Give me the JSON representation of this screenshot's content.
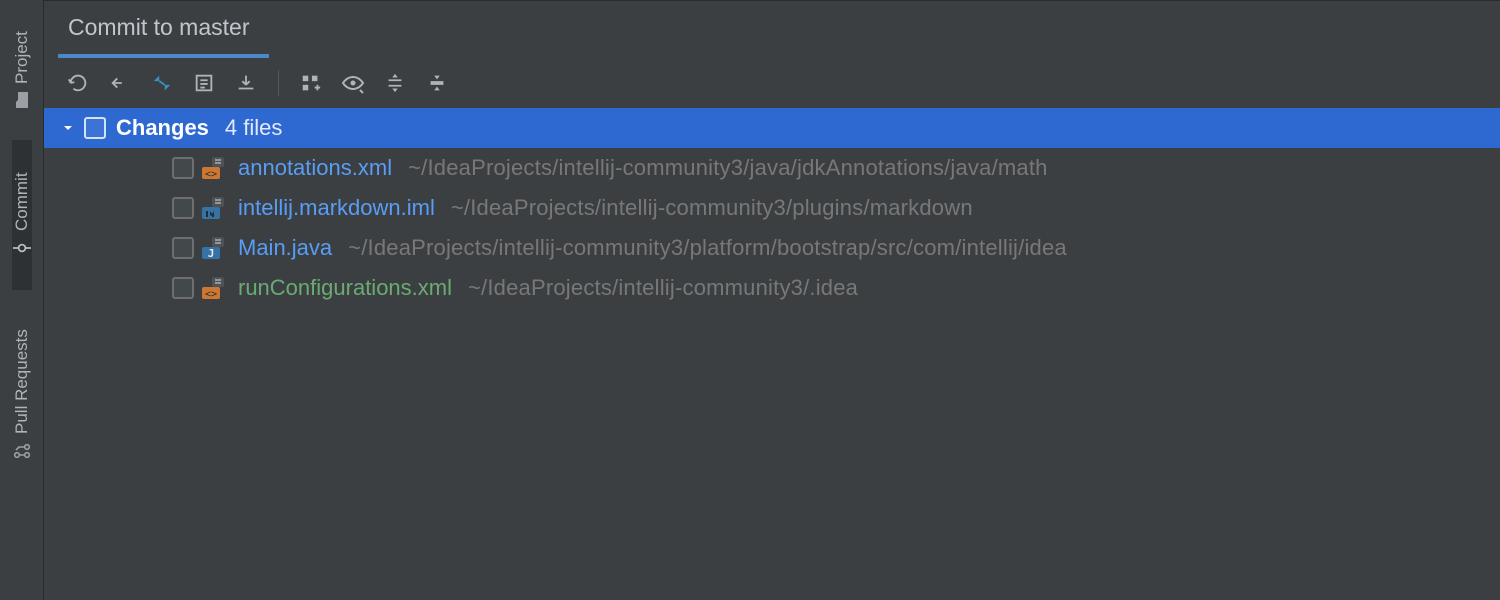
{
  "toolwindows": {
    "project": {
      "label": "Project"
    },
    "commit": {
      "label": "Commit"
    },
    "pullreq": {
      "label": "Pull Requests"
    }
  },
  "tab": {
    "title": "Commit to master"
  },
  "group": {
    "label": "Changes",
    "count": "4 files"
  },
  "files": [
    {
      "name": "annotations.xml",
      "path": "~/IdeaProjects/intellij-community3/java/jdkAnnotations/java/math",
      "color": "blue",
      "icon": "xml-modified"
    },
    {
      "name": "intellij.markdown.iml",
      "path": "~/IdeaProjects/intellij-community3/plugins/markdown",
      "color": "blue",
      "icon": "iml-modified"
    },
    {
      "name": "Main.java",
      "path": "~/IdeaProjects/intellij-community3/platform/bootstrap/src/com/intellij/idea",
      "color": "blue",
      "icon": "java-modified"
    },
    {
      "name": "runConfigurations.xml",
      "path": "~/IdeaProjects/intellij-community3/.idea",
      "color": "green",
      "icon": "xml-added"
    }
  ]
}
